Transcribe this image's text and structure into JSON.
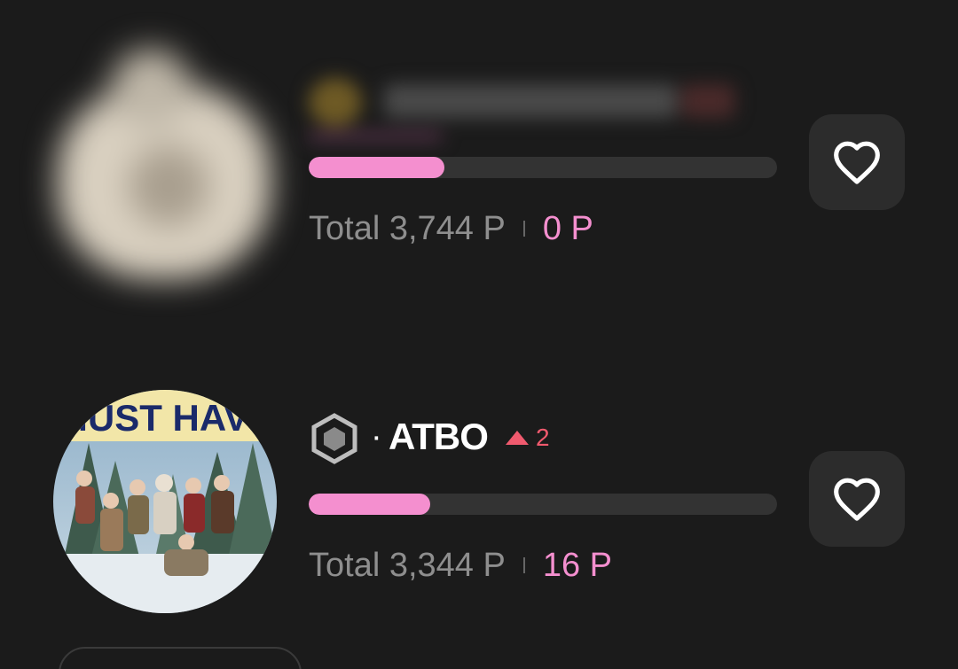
{
  "rows": [
    {
      "name": "",
      "total_label": "Total 3,744 P",
      "points_today": "0 P",
      "progress": 0.29,
      "blurred": true
    },
    {
      "name": "ATBO",
      "separator": "·",
      "rank_change": "2",
      "rank_direction": "up",
      "total_label": "Total 3,344 P",
      "points_today": "16 P",
      "progress": 0.26,
      "avatar_banner_text": "MUST HAVE"
    }
  ],
  "icons": {
    "team": "hexagon-team-icon",
    "like": "heart-outline-icon",
    "rank": "triangle-up-icon"
  },
  "colors": {
    "background": "#1b1b1b",
    "accent_pink": "#f48fcf",
    "rank_up": "#f05a6e",
    "muted_text": "#8e8e8e",
    "button_bg": "#2c2c2c"
  }
}
